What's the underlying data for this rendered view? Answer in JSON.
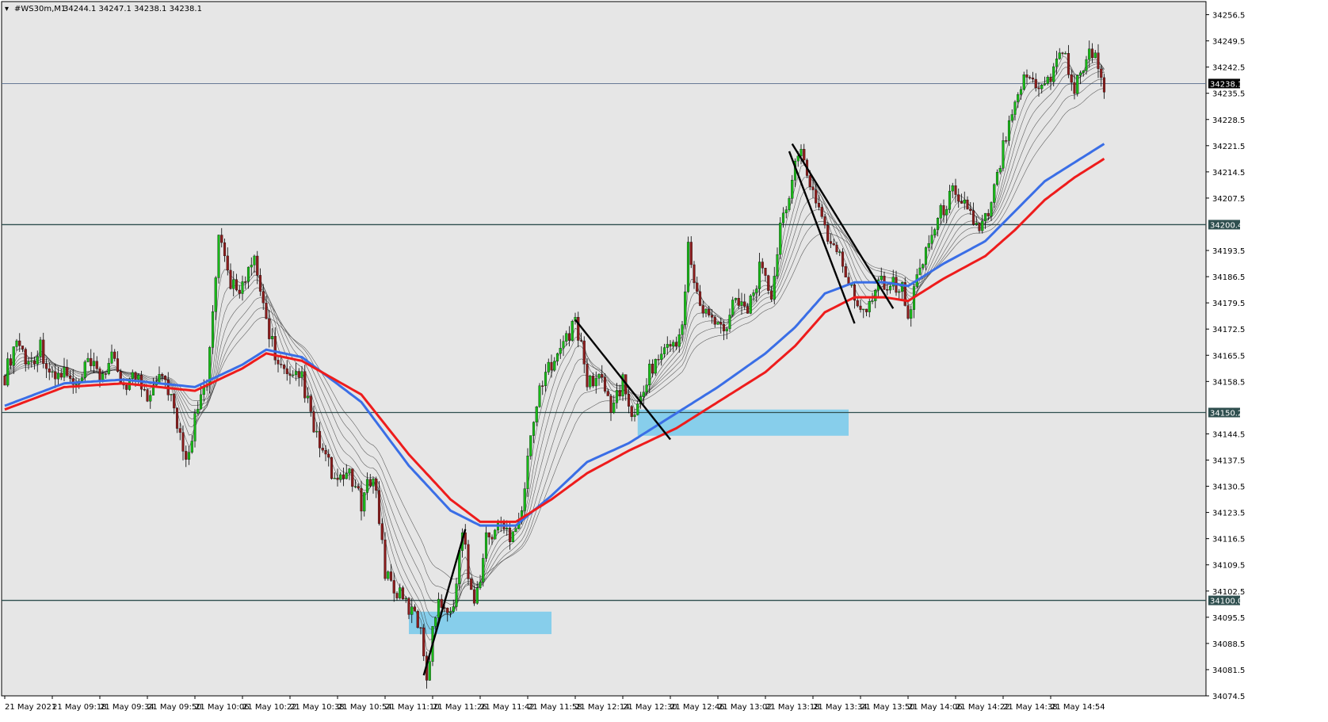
{
  "window": {
    "title": "#WS30m,M1",
    "ohlc": "34244.1 34247.1 34238.1 34238.1"
  },
  "colors": {
    "background": "#e6e6e6",
    "bull_candle": "#17b817",
    "bear_candle": "#8a1c1c",
    "wick": "#000000",
    "ema_blue": "#3a6ee6",
    "ema_red": "#ee1c1c",
    "ribbon": "#333333",
    "zone_fill": "#87ceeb",
    "level_line": "#2f4f4f",
    "current_line": "#556b8a",
    "price_tag_bg": "#2f4f4f"
  },
  "chart_data": {
    "type": "candlestick",
    "symbol": "#WS30m",
    "timeframe": "M1",
    "ylim": [
      34074.5,
      34260.0
    ],
    "y_ticks": [
      "34256.5",
      "34249.5",
      "34242.5",
      "34235.5",
      "34228.5",
      "34221.5",
      "34214.5",
      "34207.5",
      "34200.4",
      "34193.5",
      "34186.5",
      "34179.5",
      "34172.5",
      "34165.5",
      "34158.5",
      "34150.2",
      "34144.5",
      "34137.5",
      "34130.5",
      "34123.5",
      "34116.5",
      "34109.5",
      "34102.5",
      "34100.0",
      "34095.5",
      "34088.5",
      "34081.5",
      "34074.5"
    ],
    "x_ticks": [
      "21 May 2021",
      "21 May 09:18",
      "21 May 09:34",
      "21 May 09:50",
      "21 May 10:06",
      "21 May 10:22",
      "21 May 10:38",
      "21 May 10:54",
      "21 May 11:10",
      "21 May 11:26",
      "21 May 11:42",
      "21 May 11:58",
      "21 May 12:14",
      "21 May 12:30",
      "21 May 12:46",
      "21 May 13:02",
      "21 May 13:18",
      "21 May 13:34",
      "21 May 13:50",
      "21 May 14:06",
      "21 May 14:22",
      "21 May 14:38",
      "21 May 14:54"
    ],
    "bars_per_tick": 16,
    "price_path": [
      [
        0,
        34160
      ],
      [
        4,
        34170
      ],
      [
        8,
        34163
      ],
      [
        12,
        34168
      ],
      [
        16,
        34159
      ],
      [
        20,
        34161
      ],
      [
        24,
        34156
      ],
      [
        28,
        34163
      ],
      [
        32,
        34160
      ],
      [
        36,
        34164
      ],
      [
        40,
        34158
      ],
      [
        44,
        34160
      ],
      [
        48,
        34155
      ],
      [
        52,
        34162
      ],
      [
        56,
        34155
      ],
      [
        58,
        34145
      ],
      [
        62,
        34138
      ],
      [
        64,
        34152
      ],
      [
        68,
        34157
      ],
      [
        72,
        34196
      ],
      [
        76,
        34185
      ],
      [
        80,
        34184
      ],
      [
        84,
        34190
      ],
      [
        88,
        34175
      ],
      [
        92,
        34163
      ],
      [
        96,
        34158
      ],
      [
        100,
        34160
      ],
      [
        104,
        34145
      ],
      [
        108,
        34138
      ],
      [
        112,
        34130
      ],
      [
        116,
        34135
      ],
      [
        120,
        34125
      ],
      [
        124,
        34135
      ],
      [
        128,
        34108
      ],
      [
        132,
        34102
      ],
      [
        136,
        34098
      ],
      [
        140,
        34093
      ],
      [
        142,
        34080
      ],
      [
        146,
        34102
      ],
      [
        150,
        34095
      ],
      [
        154,
        34118
      ],
      [
        158,
        34098
      ],
      [
        162,
        34116
      ],
      [
        166,
        34120
      ],
      [
        170,
        34118
      ],
      [
        174,
        34124
      ],
      [
        178,
        34150
      ],
      [
        182,
        34160
      ],
      [
        186,
        34168
      ],
      [
        190,
        34170
      ],
      [
        192,
        34176
      ],
      [
        196,
        34158
      ],
      [
        200,
        34160
      ],
      [
        204,
        34152
      ],
      [
        208,
        34158
      ],
      [
        212,
        34148
      ],
      [
        216,
        34160
      ],
      [
        220,
        34165
      ],
      [
        224,
        34168
      ],
      [
        228,
        34172
      ],
      [
        230,
        34194
      ],
      [
        234,
        34178
      ],
      [
        238,
        34175
      ],
      [
        242,
        34172
      ],
      [
        246,
        34182
      ],
      [
        250,
        34178
      ],
      [
        254,
        34188
      ],
      [
        258,
        34182
      ],
      [
        262,
        34204
      ],
      [
        266,
        34215
      ],
      [
        268,
        34220
      ],
      [
        270,
        34214
      ],
      [
        274,
        34205
      ],
      [
        278,
        34195
      ],
      [
        282,
        34190
      ],
      [
        286,
        34180
      ],
      [
        290,
        34178
      ],
      [
        294,
        34186
      ],
      [
        298,
        34185
      ],
      [
        302,
        34183
      ],
      [
        304,
        34175
      ],
      [
        308,
        34190
      ],
      [
        312,
        34198
      ],
      [
        316,
        34205
      ],
      [
        320,
        34210
      ],
      [
        324,
        34205
      ],
      [
        328,
        34198
      ],
      [
        332,
        34205
      ],
      [
        336,
        34222
      ],
      [
        340,
        34235
      ],
      [
        344,
        34240
      ],
      [
        348,
        34238
      ],
      [
        352,
        34240
      ],
      [
        356,
        34248
      ],
      [
        360,
        34236
      ],
      [
        364,
        34246
      ],
      [
        368,
        34244
      ],
      [
        370,
        34238
      ]
    ],
    "ema_blue": [
      [
        0,
        34152
      ],
      [
        20,
        34158
      ],
      [
        40,
        34159
      ],
      [
        64,
        34157
      ],
      [
        80,
        34163
      ],
      [
        88,
        34167
      ],
      [
        100,
        34165
      ],
      [
        120,
        34153
      ],
      [
        136,
        34136
      ],
      [
        150,
        34124
      ],
      [
        160,
        34120
      ],
      [
        172,
        34120
      ],
      [
        184,
        34128
      ],
      [
        196,
        34137
      ],
      [
        210,
        34142
      ],
      [
        226,
        34150
      ],
      [
        240,
        34157
      ],
      [
        256,
        34166
      ],
      [
        266,
        34173
      ],
      [
        276,
        34182
      ],
      [
        286,
        34185
      ],
      [
        296,
        34185
      ],
      [
        304,
        34184
      ],
      [
        316,
        34190
      ],
      [
        330,
        34196
      ],
      [
        340,
        34204
      ],
      [
        350,
        34212
      ],
      [
        360,
        34217
      ],
      [
        370,
        34222
      ]
    ],
    "ema_red": [
      [
        0,
        34151
      ],
      [
        20,
        34157
      ],
      [
        40,
        34158
      ],
      [
        64,
        34156
      ],
      [
        80,
        34162
      ],
      [
        88,
        34166
      ],
      [
        100,
        34164
      ],
      [
        120,
        34155
      ],
      [
        136,
        34139
      ],
      [
        150,
        34127
      ],
      [
        160,
        34121
      ],
      [
        172,
        34121
      ],
      [
        184,
        34127
      ],
      [
        196,
        34134
      ],
      [
        210,
        34140
      ],
      [
        226,
        34146
      ],
      [
        240,
        34153
      ],
      [
        256,
        34161
      ],
      [
        266,
        34168
      ],
      [
        276,
        34177
      ],
      [
        286,
        34181
      ],
      [
        296,
        34181
      ],
      [
        304,
        34180
      ],
      [
        316,
        34186
      ],
      [
        330,
        34192
      ],
      [
        340,
        34199
      ],
      [
        350,
        34207
      ],
      [
        360,
        34213
      ],
      [
        370,
        34218
      ]
    ],
    "levels": [
      34200.4,
      34150.2,
      34100.0
    ],
    "current_price": 34238.1,
    "zones": [
      {
        "x0": 136,
        "x1": 184,
        "y0": 34091,
        "y1": 34097
      },
      {
        "x0": 213,
        "x1": 284,
        "y0": 34144,
        "y1": 34151
      }
    ],
    "trendlines": [
      [
        [
          141,
          34080
        ],
        [
          155,
          34119
        ]
      ],
      [
        [
          192,
          34175
        ],
        [
          224,
          34143
        ]
      ],
      [
        [
          264,
          34220
        ],
        [
          286,
          34174
        ]
      ],
      [
        [
          265,
          34222
        ],
        [
          299,
          34178
        ]
      ]
    ]
  }
}
